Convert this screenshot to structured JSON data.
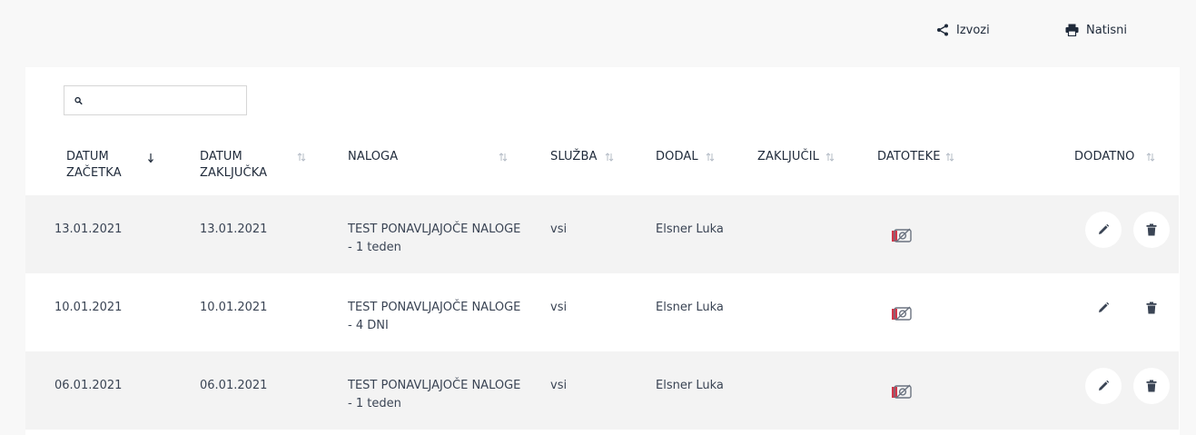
{
  "toolbar": {
    "export_label": "Izvozi",
    "print_label": "Natisni"
  },
  "search": {
    "placeholder": "",
    "value": ""
  },
  "table": {
    "columns": [
      {
        "line1": "DATUM",
        "line2": "ZAČETKA"
      },
      {
        "line1": "DATUM",
        "line2": "ZAKLJUČKA"
      },
      {
        "line1": "NALOGA",
        "line2": ""
      },
      {
        "line1": "SLUŽBA",
        "line2": ""
      },
      {
        "line1": "DODAL",
        "line2": ""
      },
      {
        "line1": "ZAKLJUČIL",
        "line2": ""
      },
      {
        "line1": "DATOTEKE",
        "line2": ""
      },
      {
        "line1": "DODATNO",
        "line2": ""
      }
    ],
    "sort_active_column": "DATUM ZAČETKA",
    "sort_direction": "descending",
    "rows": [
      {
        "start": "13.01.2021",
        "end": "13.01.2021",
        "task_line1": "TEST PONAVLJAJOČE NALOGE",
        "task_line2": "- 1 teden",
        "service": "vsi",
        "added_by": "Elsner Luka",
        "closed_by": ""
      },
      {
        "start": "10.01.2021",
        "end": "10.01.2021",
        "task_line1": "TEST PONAVLJAJOČE NALOGE",
        "task_line2": "- 4 DNI",
        "service": "vsi",
        "added_by": "Elsner Luka",
        "closed_by": ""
      },
      {
        "start": "06.01.2021",
        "end": "06.01.2021",
        "task_line1": "TEST PONAVLJAJOČE NALOGE",
        "task_line2": "- 1 teden",
        "service": "vsi",
        "added_by": "Elsner Luka",
        "closed_by": ""
      }
    ]
  },
  "colors": {
    "text": "#1f2a3a",
    "alt_row": "#f3f3f3",
    "file_icon_accent": "#d2374a"
  },
  "icons": {
    "export": "share-icon",
    "print": "printer-icon",
    "search": "search-icon",
    "file": "no-attachment-icon",
    "edit": "pencil-icon",
    "delete": "trash-icon"
  }
}
